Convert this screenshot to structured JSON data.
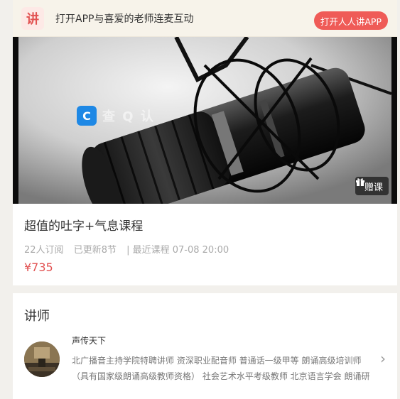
{
  "banner": {
    "logo": "讲",
    "text": "打开APP与喜爱的老师连麦互动",
    "button_label": "打开人人讲APP"
  },
  "hero": {
    "watermark_icon": "C",
    "watermark_text": "查 Q 认",
    "gift_icon": "gift-icon",
    "gift_label": "赠课"
  },
  "course": {
    "title": "超值的吐字+气息课程",
    "subscribers": "22人订阅",
    "updated": "已更新8节",
    "recent": "| 最近课程 07-08 20:00",
    "price": "¥735"
  },
  "teacher": {
    "heading": "讲师",
    "name": "声传天下",
    "description_line1": "北广播音主持学院特聘讲师 资深职业配音师 普通话一级甲等 朗诵高级培训师",
    "description_line2": "（具有国家级朗诵高级教师资格） 社会艺术水平考级教师 北京语言学会 朗诵研",
    "arrow": "›"
  },
  "colors": {
    "accent": "#ef5b57",
    "price": "#e25252",
    "banner_bg": "#f7f3ea"
  }
}
